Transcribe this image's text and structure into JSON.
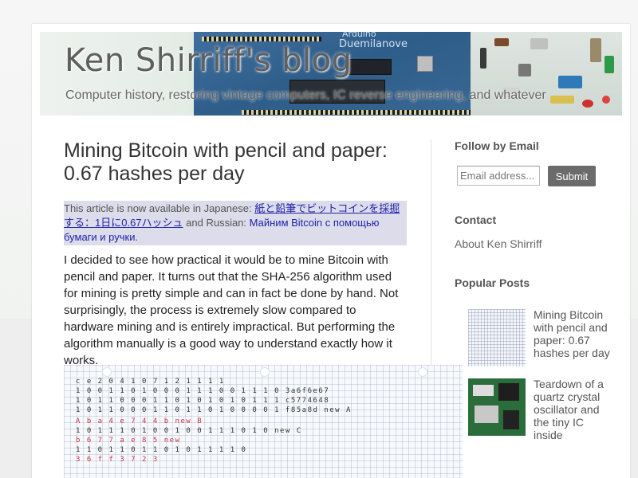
{
  "blog": {
    "title": "Ken Shirriff's blog",
    "description": "Computer history, restoring vintage computers, IC reverse engineering, and whatever",
    "header_board_text": [
      "Arduino",
      "Duemilanove"
    ]
  },
  "post": {
    "title": "Mining Bitcoin with pencil and paper: 0.67 hashes per day",
    "notice_prefix": "This article is now available in Japanese: ",
    "notice_japanese_link": "紙と鉛筆でビットコインを採掘する：1日に0.67ハッシュ",
    "notice_middle": " and Russian: ",
    "notice_russian_link": "Майним Bitcoin с помощью бумаги и ручки",
    "notice_suffix": ".",
    "body": "I decided to see how practical it would be to mine Bitcoin with pencil and paper. It turns out that the SHA-256 algorithm used for mining is pretty simple and can in fact be done by hand. Not surprisingly, the process is extremely slow compared to hardware mining and is entirely impractical. But performing the algorithm manually is a good way to understand exactly how it works.",
    "image_rows": [
      "c  e   2   0    4   1   0    7   1 2 1 1 1 1",
      "1 0 0 1 1 0 1 0 0 0 1 1 1 0 0 1 1 1 0  3a6f6e67",
      "1 0 1 1 0 0 0 1 1 0 1 0 1 0 1 0 1 1 1  c5774648",
      "1 0 1 1 0 0 0 1 1 0 1 1 0 1 0 0 0 0 1  f85a8d  new A",
      "A  b  a   4   e   7   4   4   b        new B",
      "1 0 1 1 1 0 1 0 0 1 0 0 1 1 1 0 1 0   new C",
      "b  6   7   7   a   e   8   5          new",
      "1 1 0 1 1 0 1 1 0 1 0 1 1 1 1 0",
      "3  6   f   f   3   7   2   3"
    ]
  },
  "sidebar": {
    "follow_title": "Follow by Email",
    "email_placeholder": "Email address...",
    "submit_label": "Submit",
    "contact_title": "Contact",
    "contact_link": "About Ken Shirriff",
    "popular_title": "Popular Posts",
    "popular_posts": [
      {
        "title": "Mining Bitcoin with pencil and paper: 0.67 hashes per day",
        "thumb": "handwritten-hash-grid"
      },
      {
        "title": "Teardown of a quartz crystal oscillator and the tiny IC inside",
        "thumb": "green-circuit-board"
      }
    ]
  },
  "colors": {
    "notice_bg": "#dcdcea",
    "link": "#2222aa",
    "button_bg": "#6b6b6b"
  }
}
